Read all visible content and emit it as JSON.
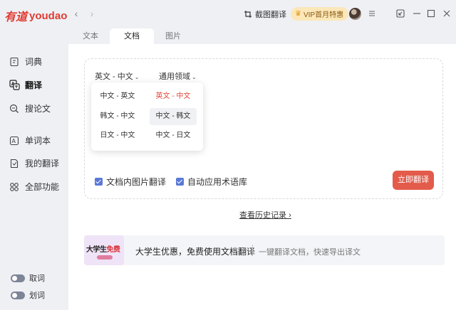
{
  "app": {
    "logo_cn": "有道",
    "logo_en": "youdao"
  },
  "titlebar": {
    "screenshot_label": "截图翻译",
    "vip_label": "VIP首月特惠"
  },
  "sidebar": {
    "items": [
      {
        "label": "词典",
        "icon": "dictionary-icon"
      },
      {
        "label": "翻译",
        "icon": "translate-icon"
      },
      {
        "label": "搜论文",
        "icon": "search-paper-icon"
      },
      {
        "label": "单词本",
        "icon": "wordbook-icon"
      },
      {
        "label": "我的翻译",
        "icon": "my-translation-icon"
      },
      {
        "label": "全部功能",
        "icon": "all-features-icon"
      }
    ],
    "toggles": [
      {
        "label": "取词",
        "on": true
      },
      {
        "label": "划词",
        "on": true
      }
    ]
  },
  "tabs": [
    {
      "label": "文本"
    },
    {
      "label": "文档"
    },
    {
      "label": "图片"
    }
  ],
  "main": {
    "lang_select": "英文 - 中文",
    "domain_select": "通用领域",
    "lang_options": [
      {
        "label": "中文 - 英文"
      },
      {
        "label": "英文 - 中文"
      },
      {
        "label": "韩文 - 中文"
      },
      {
        "label": "中文 - 韩文"
      },
      {
        "label": "日文 - 中文"
      },
      {
        "label": "中文 - 日文"
      }
    ],
    "check_image_translate": "文档内图片翻译",
    "check_term_library": "自动应用术语库",
    "translate_button": "立即翻译",
    "history_link": "查看历史记录"
  },
  "promo": {
    "badge_text": "大学生",
    "badge_highlight": "免费",
    "title": "大学生优惠，免费使用文档翻译",
    "subtitle": "一键翻译文档，快速导出译文"
  },
  "colors": {
    "accent_red": "#e35b4b",
    "checkbox_blue": "#5a78d8",
    "vip_bg": "#fbe7b8"
  }
}
